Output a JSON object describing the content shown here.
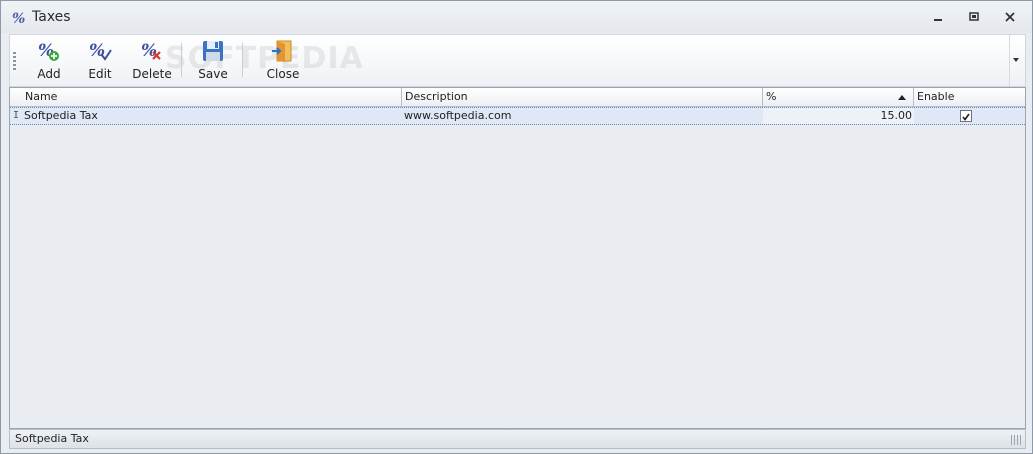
{
  "window": {
    "title": "Taxes"
  },
  "toolbar": {
    "buttons": [
      {
        "label": "Add",
        "icon": "percent-add-icon"
      },
      {
        "label": "Edit",
        "icon": "percent-edit-icon"
      },
      {
        "label": "Delete",
        "icon": "percent-delete-icon"
      },
      {
        "label": "Save",
        "icon": "floppy-disk-icon"
      },
      {
        "label": "Close",
        "icon": "exit-door-icon"
      }
    ],
    "watermark": "SOFTPEDIA"
  },
  "grid": {
    "columns": [
      "Name",
      "Description",
      "%",
      "Enable"
    ],
    "sort_column": "%",
    "rows": [
      {
        "name": "Softpedia Tax",
        "description": "www.softpedia.com",
        "percent": "15.00",
        "enabled": true
      }
    ]
  },
  "status": {
    "text": "Softpedia Tax"
  },
  "colors": {
    "accent": "#dfe8f6",
    "border": "#9aa3af"
  }
}
